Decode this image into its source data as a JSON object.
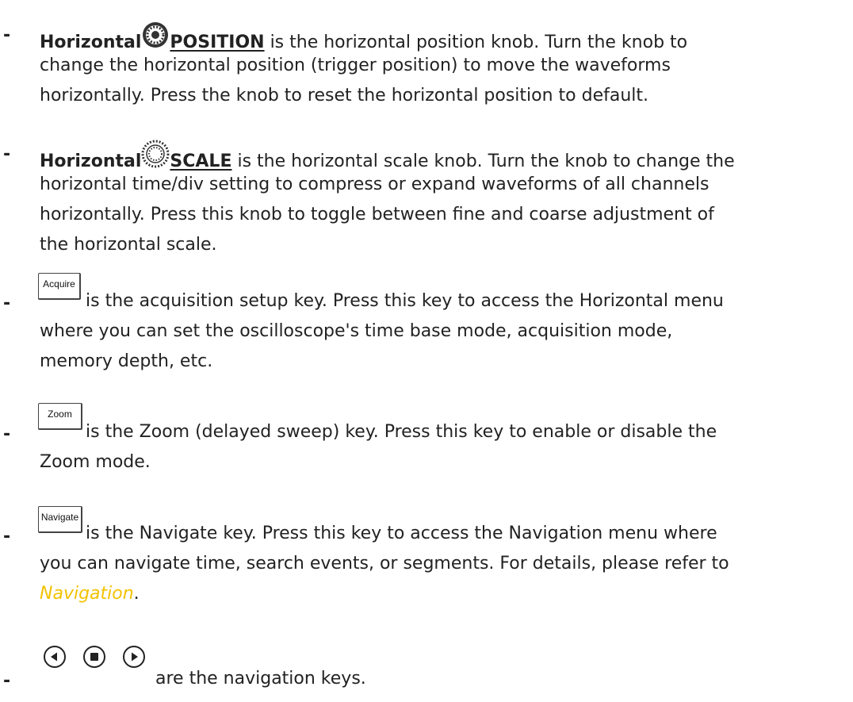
{
  "items": [
    {
      "bold_prefix": "Horizontal",
      "knob_label": "POSITION",
      "lines": [
        " is the horizontal position knob. Turn the knob to",
        "change the horizontal position (trigger position) to move the waveforms",
        "horizontally. Press the knob to reset the horizontal position to default."
      ],
      "knob_icon": "position-knob-icon"
    },
    {
      "bold_prefix": "Horizontal",
      "knob_label": "SCALE",
      "lines": [
        " is the horizontal scale knob. Turn the knob to change the",
        "horizontal time/div setting to compress or expand waveforms of all channels",
        "horizontally. Press this knob to toggle between fine and coarse adjustment of",
        "the horizontal scale."
      ],
      "knob_icon": "scale-knob-icon"
    },
    {
      "key_label": "Acquire",
      "lines": [
        "is the acquisition setup key. Press this key to access the Horizontal menu",
        "where you can set the oscilloscope's time base mode, acquisition mode,",
        "memory depth, etc."
      ]
    },
    {
      "key_label": "Zoom",
      "lines": [
        "is the Zoom (delayed sweep) key. Press this key to enable or disable the",
        "Zoom mode."
      ]
    },
    {
      "key_label": "Navigate",
      "lines": [
        "is the Navigate key. Press this key to access the Navigation menu where",
        "you can navigate time, search events, or segments. For details, please refer to"
      ],
      "link_text": "Navigation",
      "after_link": "."
    },
    {
      "nav_keys": [
        "play-backward-icon",
        "stop-icon",
        "play-forward-icon"
      ],
      "text": "are the navigation keys."
    }
  ],
  "dash": "-",
  "link_color": "#f2c200"
}
